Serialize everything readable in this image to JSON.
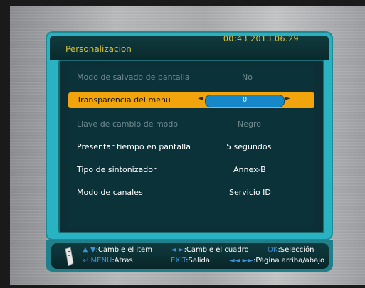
{
  "window": {
    "title": "Personalizacion",
    "clock": "00:43  2013.06.29"
  },
  "menu": [
    {
      "label": "Modo de salvado de pantalla",
      "value": "No",
      "state": "disabled"
    },
    {
      "label": "Transparencia del menu",
      "value": "0",
      "state": "selected"
    },
    {
      "label": "Llave de cambio de modo",
      "value": "Negro",
      "state": "disabled"
    },
    {
      "label": "Presentar tiempo en pantalla",
      "value": "5 segundos",
      "state": "normal"
    },
    {
      "label": "Tipo de sintonizador",
      "value": "Annex-B",
      "state": "normal"
    },
    {
      "label": "Modo de canales",
      "value": "Servicio ID",
      "state": "normal"
    }
  ],
  "help": {
    "line1": {
      "updown_keys": "▲ ▼",
      "updown_text": ":Cambie el item",
      "leftright_keys": "◄ ►",
      "leftright_text": ":Cambie el cuadro",
      "ok_key": "OK",
      "ok_text": ":Selección"
    },
    "line2": {
      "menu_keys": "↩ MENU",
      "menu_text": ":Atras",
      "exit_key": "EXIT",
      "exit_text": ":Salida",
      "page_keys": "◄◄ ►►",
      "page_text": ":Página arriba/abajo"
    }
  },
  "colors": {
    "frame": "#29b3c2",
    "selection": "#f2a40d",
    "title": "#d9c030",
    "value_pill": "#1687c9"
  }
}
